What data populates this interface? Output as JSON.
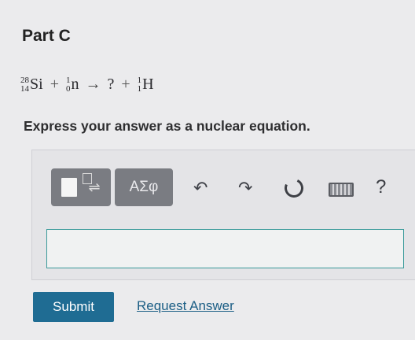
{
  "part": {
    "title": "Part C"
  },
  "question": {
    "reactant1": {
      "symbol": "Si",
      "mass": "28",
      "atomic": "14"
    },
    "plus1": "+",
    "reactant2": {
      "symbol": "n",
      "mass": "1",
      "atomic": "0"
    },
    "arrow": "→",
    "unknown": "?",
    "plus2": "+",
    "product2": {
      "symbol": "H",
      "mass": "1",
      "atomic": "1"
    },
    "instruction": "Express your answer as a nuclear equation."
  },
  "toolbar": {
    "greek_label": "ΑΣφ",
    "templates_icon": "templates-icon",
    "undo_icon": "undo-icon",
    "redo_icon": "redo-icon",
    "reset_icon": "reset-icon",
    "keyboard_icon": "keyboard-icon",
    "help_label": "?"
  },
  "answer": {
    "value": ""
  },
  "actions": {
    "submit_label": "Submit",
    "request_label": "Request Answer"
  },
  "colors": {
    "submit_bg": "#1f6c93",
    "link": "#1b5e85",
    "input_border": "#3a9a9a",
    "tool_button": "#7a7c82"
  }
}
